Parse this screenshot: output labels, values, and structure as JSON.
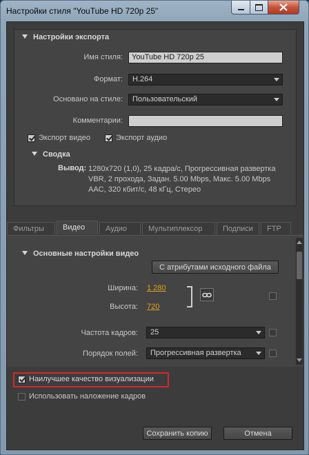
{
  "window": {
    "title": "Настройки стиля \"YouTube HD 720p 25\""
  },
  "export": {
    "section_title": "Настройки экспорта",
    "style_name_label": "Имя стиля:",
    "style_name_value": "YouTube HD 720p 25",
    "format_label": "Формат:",
    "format_value": "H.264",
    "based_on_label": "Основано на стиле:",
    "based_on_value": "Пользовательский",
    "comments_label": "Комментарии:",
    "comments_value": "",
    "export_video_label": "Экспорт видео",
    "export_audio_label": "Экспорт аудио",
    "summary_title": "Сводка",
    "output_label": "Вывод:",
    "output_line1": "1280x720 (1,0), 25 кадра/с, Прогрессивная развертка",
    "output_line2": "VBR, 2 прохода, Задан. 5.00 Mbps, Макс. 5.00 Mbps",
    "output_line3": "AAC, 320 кбит/с, 48 кГц, Стерео"
  },
  "tabs": [
    {
      "label": "Фильтры"
    },
    {
      "label": "Видео"
    },
    {
      "label": "Аудио"
    },
    {
      "label": "Мультиплексор"
    },
    {
      "label": "Подписи"
    },
    {
      "label": "FTP"
    }
  ],
  "video": {
    "section_title": "Основные настройки видео",
    "match_source_button": "С атрибутами исходного файла",
    "width_label": "Ширина:",
    "width_value": "1 280",
    "height_label": "Высота:",
    "height_value": "720",
    "framerate_label": "Частота кадров:",
    "framerate_value": "25",
    "field_order_label": "Порядок полей:",
    "field_order_value": "Прогрессивная развертка"
  },
  "bottom": {
    "max_render_quality": "Наилучшее качество визуализации",
    "use_frame_blending": "Использовать наложение кадров",
    "save_copy_button": "Сохранить копию",
    "cancel_button": "Отмена"
  }
}
